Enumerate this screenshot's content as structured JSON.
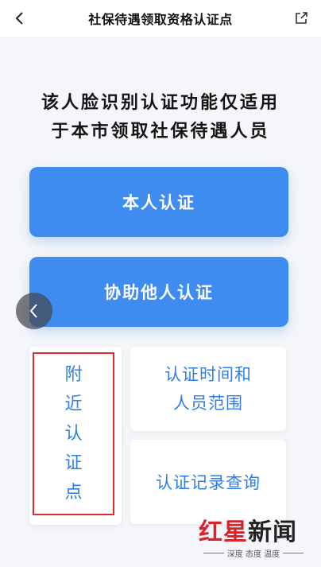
{
  "header": {
    "title": "社保待遇领取资格认证点",
    "back_icon": "chevron-left-icon",
    "share_icon": "share-icon"
  },
  "notice": {
    "line1": "该人脸识别认证功能仅适用",
    "line2": "于本市领取社保待遇人员"
  },
  "buttons": {
    "self_auth": "本人认证",
    "help_auth": "协助他人认证"
  },
  "cards": {
    "nearby": [
      "附",
      "近",
      "认",
      "证",
      "点"
    ],
    "time_line1": "认证时间和",
    "time_line2": "人员范围",
    "query": "认证记录查询"
  },
  "watermark": {
    "logo_red": "红星",
    "logo_black": "新闻",
    "slogan": "深度 态度 温度"
  },
  "colors": {
    "accent": "#3f8cf0",
    "link_text": "#2f7ee8",
    "highlight_frame": "#e32b2b",
    "background": "#f4f6f9"
  }
}
